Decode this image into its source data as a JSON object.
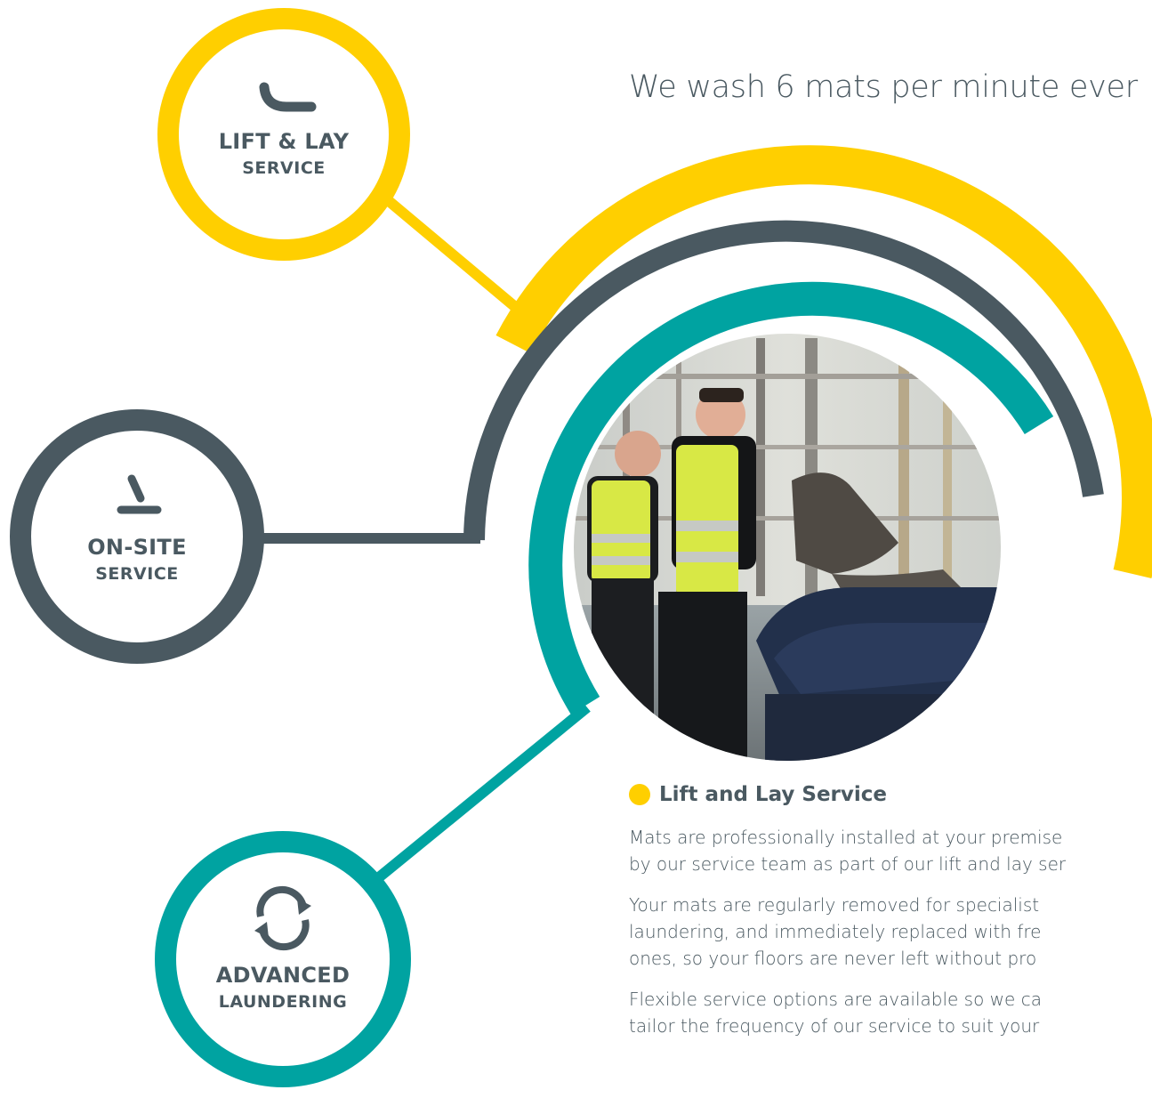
{
  "colors": {
    "yellow": "#ffcf00",
    "slate": "#4a5961",
    "teal": "#00a3a1",
    "text": "#4a5961"
  },
  "headline": "We wash 6 mats per minute ever",
  "nodes": {
    "lift_lay": {
      "line1": "LIFT & LAY",
      "line2": "SERVICE",
      "icon": "lift-and-lay-icon"
    },
    "on_site": {
      "line1": "ON-SITE",
      "line2": "SERVICE",
      "icon": "on-site-icon"
    },
    "advanced": {
      "line1": "ADVANCED",
      "line2": "LAUNDERING",
      "icon": "refresh-cycle-icon"
    }
  },
  "photo": {
    "description_icon": "workers-handling-mats-photo"
  },
  "service": {
    "title": "Lift and Lay Service",
    "paragraphs": [
      [
        "Mats are professionally installed at your premise",
        "by our service team as part of our lift and lay ser"
      ],
      [
        "Your mats are regularly removed for specialist",
        "laundering, and immediately replaced with fre",
        "ones, so your floors are never left without pro"
      ],
      [
        "Flexible service options are available so we ca",
        "tailor the frequency of our service to suit your"
      ]
    ]
  }
}
